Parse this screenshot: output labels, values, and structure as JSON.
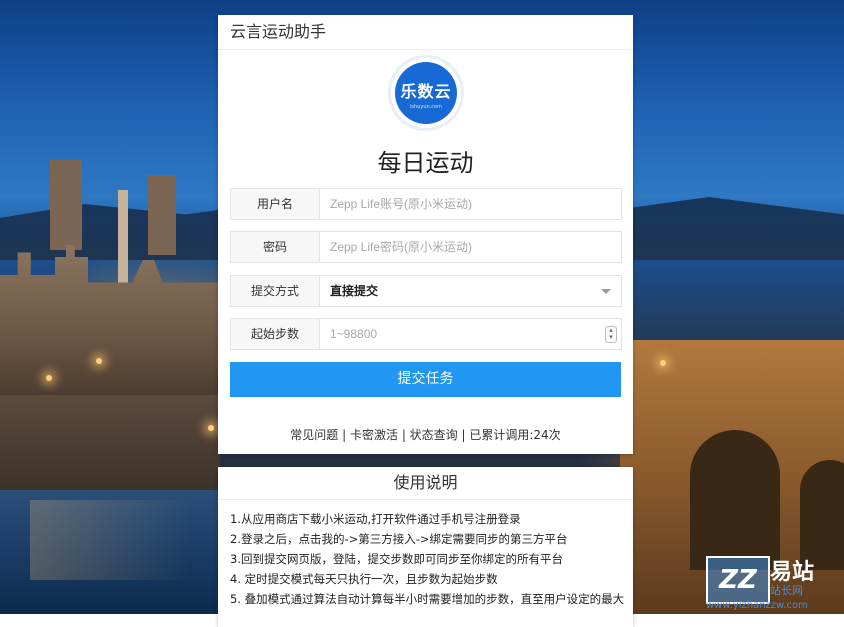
{
  "card": {
    "header_title": "云言运动助手",
    "logo_text": "乐数云",
    "logo_sub": "lshuyun.com",
    "main_title": "每日运动"
  },
  "form": {
    "username": {
      "label": "用户名",
      "placeholder": "Zepp Life账号(原小米运动)"
    },
    "password": {
      "label": "密码",
      "placeholder": "Zepp Life密码(原小米运动)"
    },
    "submit_mode": {
      "label": "提交方式",
      "value": "直接提交"
    },
    "steps": {
      "label": "起始步数",
      "placeholder": "1~98800"
    },
    "submit_label": "提交任务"
  },
  "footer": {
    "faq": "常见问题",
    "sep1": " | ",
    "activate": "卡密激活",
    "sep2": " | ",
    "status": "状态查询",
    "sep3": " | ",
    "count": "已累计调用:24次"
  },
  "usage": {
    "title": "使用说明",
    "items": [
      "1.从应用商店下载小米运动,打开软件通过手机号注册登录",
      "2.登录之后，点击我的->第三方接入->绑定需要同步的第三方平台",
      "3.回到提交网页版，登陆，提交步数即可同步至你绑定的所有平台",
      "4. 定时提交模式每天只执行一次，且步数为起始步数",
      "5. 叠加模式通过算法自动计算每半小时需要增加的步数，直至用户设定的最大"
    ]
  },
  "watermark": {
    "logo": "ZZ",
    "title": "易站",
    "subtitle": "站长网",
    "url": "www.yizhanzzw.com"
  },
  "colors": {
    "accent": "#2196f3",
    "logo_blue": "#1769d6"
  }
}
